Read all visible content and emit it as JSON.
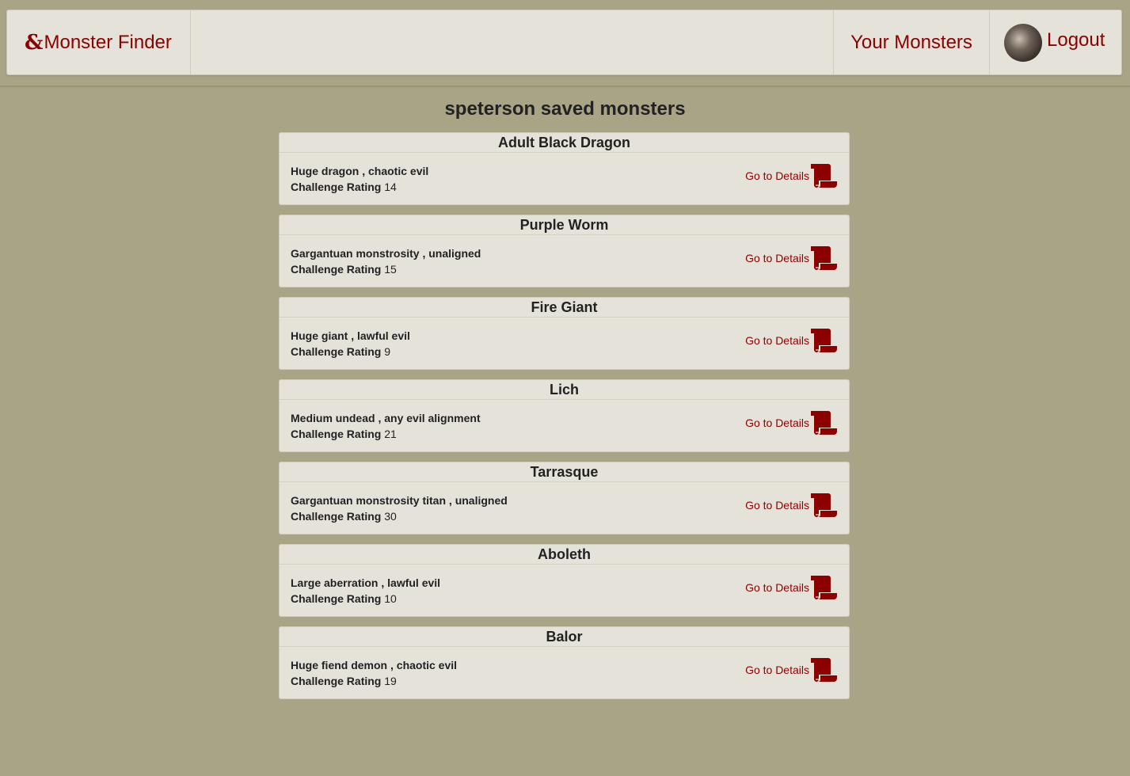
{
  "nav": {
    "brand_icon": "&",
    "brand_label": "Monster Finder",
    "your_monsters_label": "Your Monsters",
    "logout_label": "Logout"
  },
  "page": {
    "title": "speterson saved monsters"
  },
  "monsters": [
    {
      "name": "Adult Black Dragon",
      "type_line": "Huge dragon , chaotic evil",
      "cr_label": "Challenge Rating",
      "cr": "14",
      "link_label": "Go to Details"
    },
    {
      "name": "Purple Worm",
      "type_line": "Gargantuan monstrosity , unaligned",
      "cr_label": "Challenge Rating",
      "cr": "15",
      "link_label": "Go to Details"
    },
    {
      "name": "Fire Giant",
      "type_line": "Huge giant , lawful evil",
      "cr_label": "Challenge Rating",
      "cr": "9",
      "link_label": "Go to Details"
    },
    {
      "name": "Lich",
      "type_line": "Medium undead , any evil alignment",
      "cr_label": "Challenge Rating",
      "cr": "21",
      "link_label": "Go to Details"
    },
    {
      "name": "Tarrasque",
      "type_line": "Gargantuan monstrosity titan , unaligned",
      "cr_label": "Challenge Rating",
      "cr": "30",
      "link_label": "Go to Details"
    },
    {
      "name": "Aboleth",
      "type_line": "Large aberration , lawful evil",
      "cr_label": "Challenge Rating",
      "cr": "10",
      "link_label": "Go to Details"
    },
    {
      "name": "Balor",
      "type_line": "Huge fiend demon , chaotic evil",
      "cr_label": "Challenge Rating",
      "cr": "19",
      "link_label": "Go to Details"
    }
  ],
  "icons": {
    "details": "scroll-icon",
    "brand": "ampersand-dragon-icon"
  },
  "colors": {
    "accent": "#8b0000",
    "background": "#aaa487",
    "card": "#e5e2d9"
  }
}
